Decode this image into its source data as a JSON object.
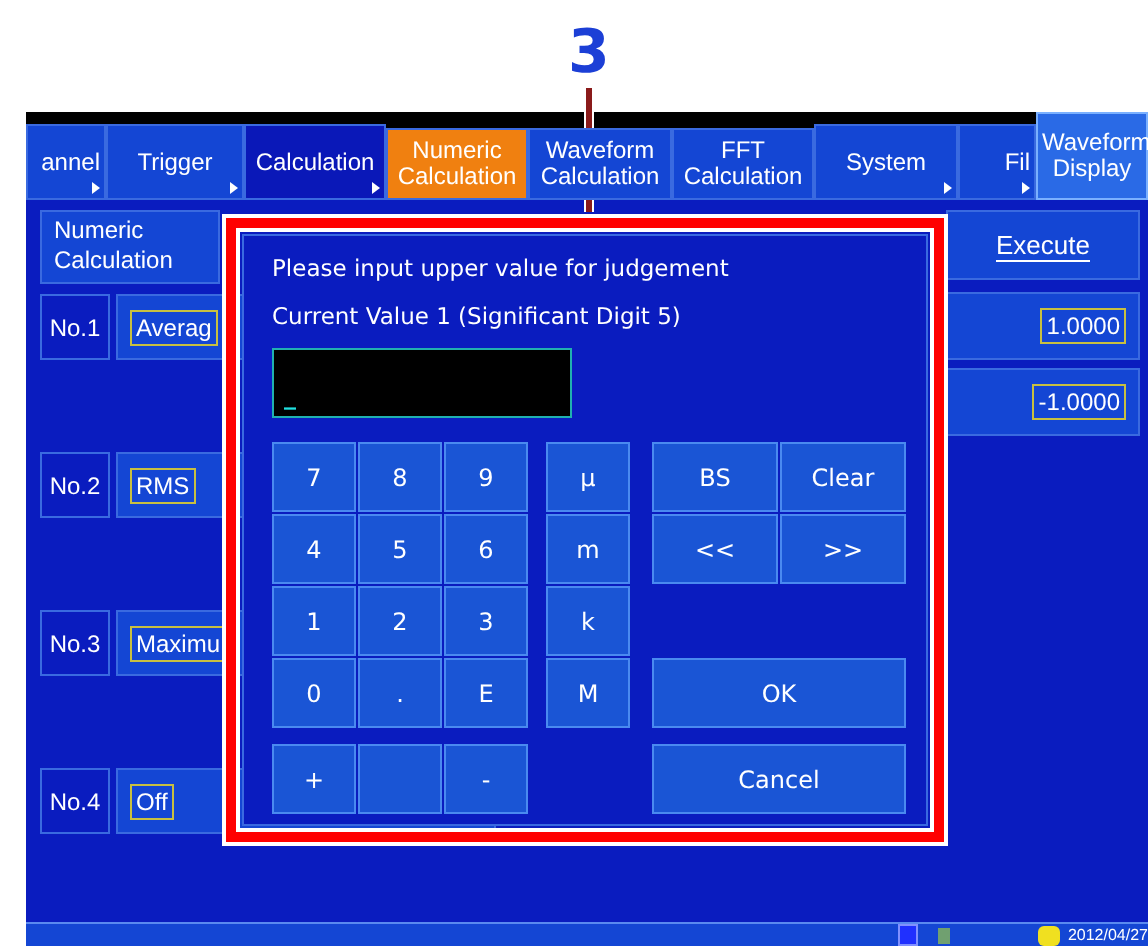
{
  "callout": {
    "number": "3"
  },
  "tabs": [
    {
      "label": "annel",
      "kind": "main",
      "selected": false
    },
    {
      "label": "Trigger",
      "kind": "main",
      "selected": false
    },
    {
      "label": "Calculation",
      "kind": "main",
      "selected": true
    },
    {
      "label": "Numeric Calculation",
      "kind": "sub",
      "selected": true
    },
    {
      "label": "Waveform Calculation",
      "kind": "sub",
      "selected": false
    },
    {
      "label": "FFT Calculation",
      "kind": "sub",
      "selected": false
    },
    {
      "label": "System",
      "kind": "main",
      "selected": false
    },
    {
      "label": "Fil",
      "kind": "main",
      "selected": false
    },
    {
      "label": "Waveform Display",
      "kind": "display",
      "selected": false
    }
  ],
  "panel": {
    "header": "Numeric Calculation",
    "rows": [
      {
        "label": "No.1",
        "value": "Averag"
      },
      {
        "label": "No.2",
        "value": "RMS"
      },
      {
        "label": "No.3",
        "value": "Maximu"
      },
      {
        "label": "No.4",
        "value": "Off"
      }
    ],
    "execute": "Execute",
    "values": [
      "1.0000",
      "-1.0000"
    ]
  },
  "dialog": {
    "prompt": "Please input upper value for judgement",
    "current": "Current Value 1 (Significant Digit 5)",
    "input": {
      "value": "_"
    },
    "keys": [
      {
        "kind": "key",
        "label": "7"
      },
      {
        "kind": "key",
        "label": "8"
      },
      {
        "kind": "key",
        "label": "9"
      },
      {
        "kind": "key",
        "label": "µ"
      },
      {
        "kind": "key",
        "label": "4"
      },
      {
        "kind": "key",
        "label": "5"
      },
      {
        "kind": "key",
        "label": "6"
      },
      {
        "kind": "key",
        "label": "m"
      },
      {
        "kind": "key",
        "label": "1"
      },
      {
        "kind": "key",
        "label": "2"
      },
      {
        "kind": "key",
        "label": "3"
      },
      {
        "kind": "key",
        "label": "k"
      },
      {
        "kind": "key",
        "label": "0"
      },
      {
        "kind": "key",
        "label": "."
      },
      {
        "kind": "key",
        "label": "E"
      },
      {
        "kind": "key",
        "label": "M"
      },
      {
        "kind": "key",
        "label": "+"
      },
      {
        "kind": "blank"
      },
      {
        "kind": "key",
        "label": "-"
      }
    ],
    "action_rows": [
      {
        "kind": "pair",
        "keys": [
          "BS",
          "Clear"
        ]
      },
      {
        "kind": "pair",
        "keys": [
          "<<",
          ">>"
        ]
      },
      {
        "kind": "wide",
        "keys": [
          "OK"
        ]
      },
      {
        "kind": "wide",
        "keys": [
          "Cancel"
        ]
      }
    ]
  },
  "status_bar": {
    "date": "2012/04/27"
  }
}
